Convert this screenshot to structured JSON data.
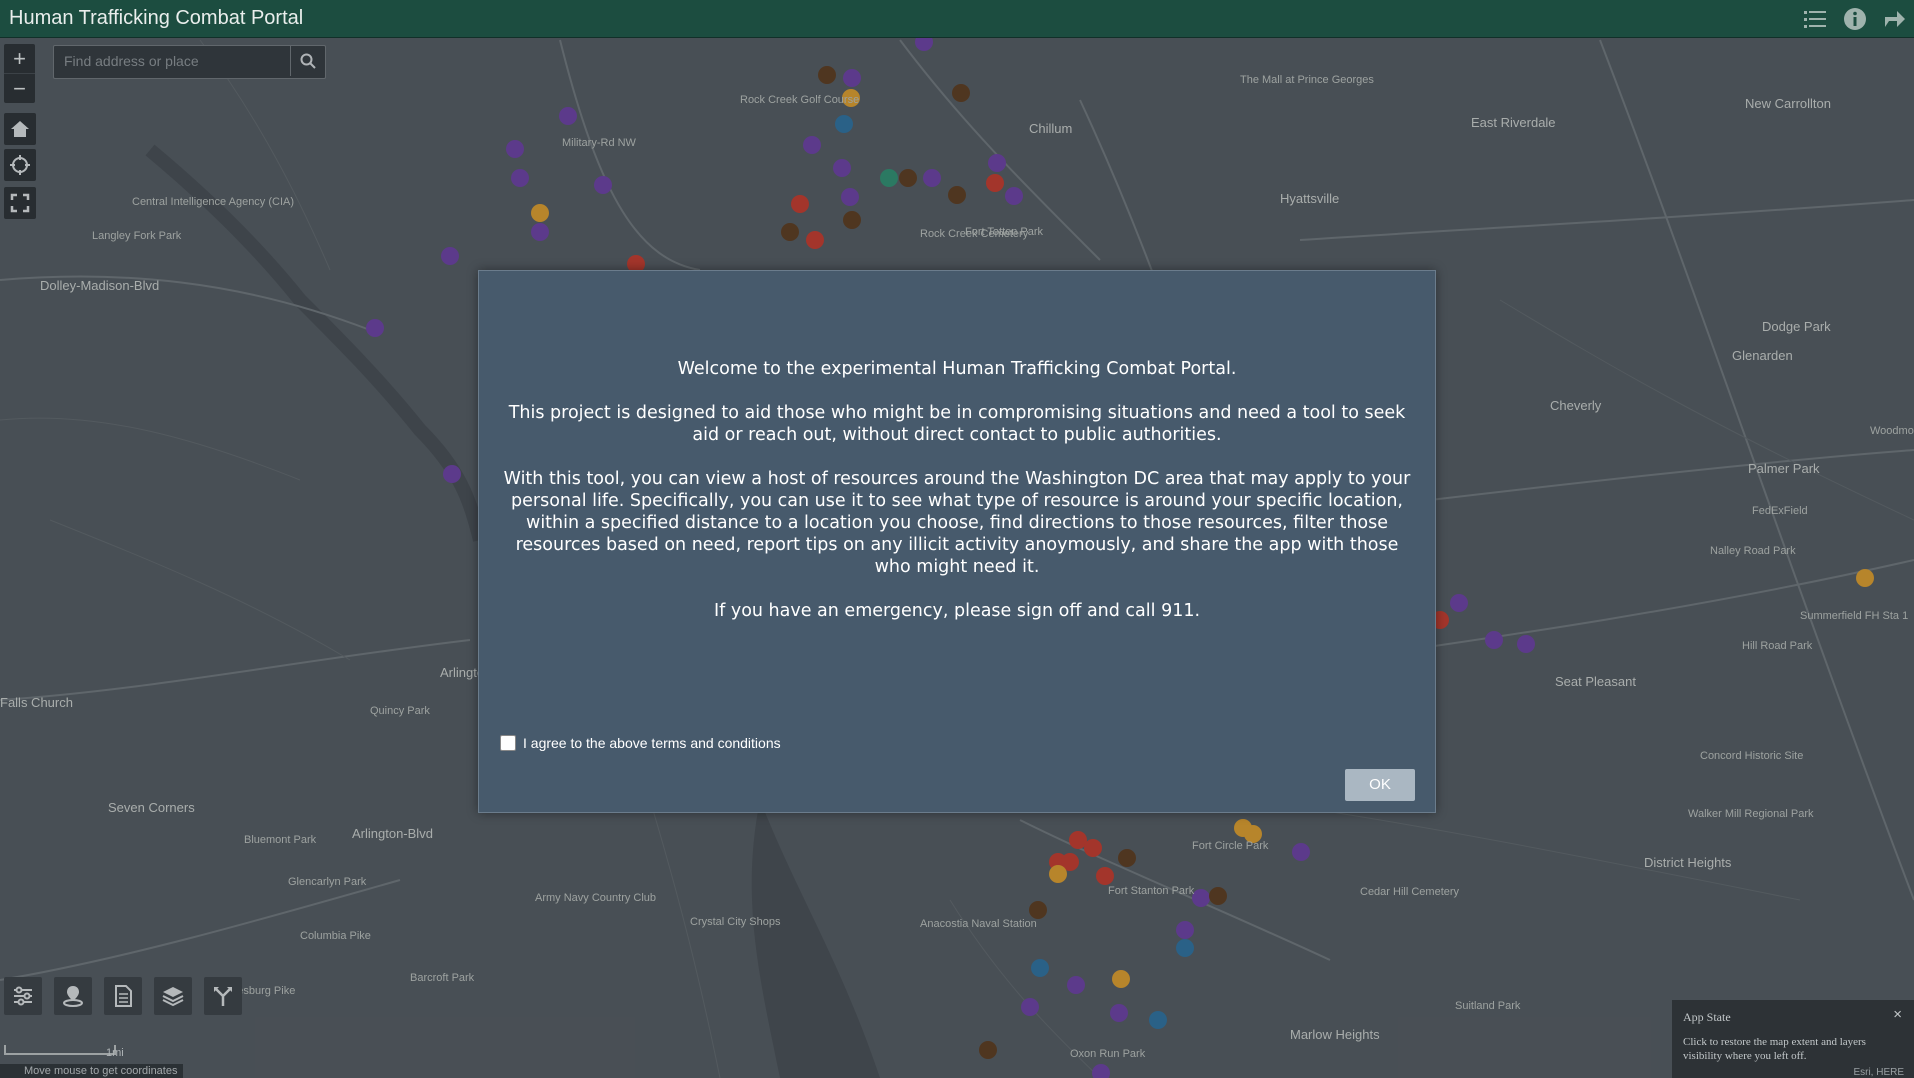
{
  "header": {
    "title": "Human Trafficking Combat Portal",
    "icons": [
      "list-icon",
      "info-icon",
      "share-icon"
    ]
  },
  "map": {
    "search_placeholder": "Find address or place",
    "zoom_in": "+",
    "zoom_out": "−",
    "scale_label": "1mi",
    "coords_text": "Move mouse to get coordinates",
    "attribution": "Esri, HERE",
    "labels": [
      "Chillum",
      "East Riverdale",
      "New Carrollton",
      "Hyattsville",
      "Dodge Park",
      "Glenarden",
      "Cheverly",
      "Palmer Park",
      "Seat Pleasant",
      "District Heights",
      "Arlington",
      "Falls Church",
      "Seven Corners",
      "Marlow Heights",
      "Military-Rd NW",
      "Rock Creek Cemetery",
      "Rock Creek Golf Course",
      "Fort Totten Park",
      "Oxon Run Park",
      "Fort Stanton Park",
      "Anacostia Naval Station",
      "Army Navy Country Club",
      "Crystal City Shops",
      "Barcroft Park",
      "Glencarlyn Park",
      "Bluemont Park",
      "Quincy Park",
      "Central Intelligence Agency (CIA)",
      "Langley Fork Park",
      "Dolley-Madison-Blvd",
      "Arlington-Blvd",
      "Columbia Pike",
      "Leesburg Pike",
      "Cedar Hill Cemetery",
      "Suitland Park",
      "Walker Mill Regional Park",
      "Concord Historic Site",
      "Summerfield FH Sta 1",
      "Hill Road Park",
      "Nalley Road Park",
      "Fort Circle Park",
      "Seat Pleasant",
      "FedExField",
      "Woodmore Town Centre",
      "Carrollton",
      "The Mall at Prince Georges"
    ]
  },
  "modal": {
    "welcome": "Welcome to the experimental Human Trafficking Combat Portal.",
    "paragraph1": "This project is designed to aid those who might be in compromising situations and need a tool to seek aid or reach out, without direct contact to public authorities.",
    "paragraph2": "With this tool, you can view a host of resources around the Washington DC area that may apply to your personal life. Specifically, you can use it to see what type of resource is around your specific location, within a specified distance to a location you choose, find directions to those resources, filter those resources based on need, report tips on any illicit activity anoymously, and share the app with those who might need it.",
    "paragraph3": "If you have an emergency, please sign off and call 911.",
    "agree_label": "I agree to the above terms and conditions",
    "agree_checked": false,
    "ok_label": "OK"
  },
  "app_state": {
    "title": "App State",
    "description": "Click to restore the map extent and layers visibility where you left off.",
    "close": "×"
  },
  "colors": {
    "header_bg": "#1c4d40",
    "modal_bg": "#475a6c",
    "ok_button": "#aab7c2",
    "marker_purple": "#6a3fa0",
    "marker_brown": "#5a3a1e",
    "marker_red": "#c0392b",
    "marker_orange": "#d89a2b",
    "marker_blue": "#2c6e9b"
  }
}
